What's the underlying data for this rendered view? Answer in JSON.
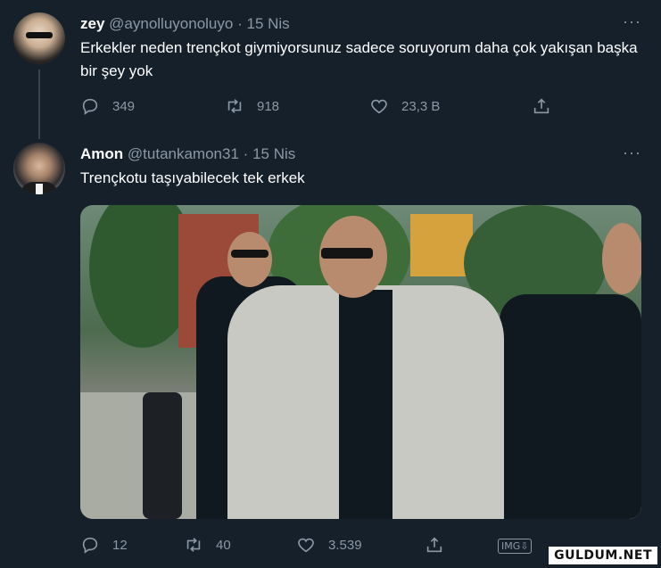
{
  "tweets": [
    {
      "name": "zey",
      "handle": "@aynolluyonoluyo",
      "separator": "·",
      "date": "15 Nis",
      "more": "···",
      "text": "Erkekler neden trençkot giymiyorsunuz sadece soruyorum daha çok yakışan başka bir şey yok",
      "replies": "349",
      "retweets": "918",
      "likes": "23,3 B"
    },
    {
      "name": "Amon",
      "handle": "@tutankamon31",
      "separator": "·",
      "date": "15 Nis",
      "more": "···",
      "text": "Trençkotu taşıyabilecek tek erkek",
      "replies": "12",
      "retweets": "40",
      "likes": "3.539",
      "img_badge": "IMG⇩"
    }
  ],
  "watermark": "GULDUM.NET",
  "icons": [
    "reply-icon",
    "retweet-icon",
    "like-icon",
    "share-icon",
    "more-icon"
  ],
  "colors": {
    "background": "#15202b",
    "secondary_text": "#8b98a5",
    "thread_line": "#38444d"
  }
}
